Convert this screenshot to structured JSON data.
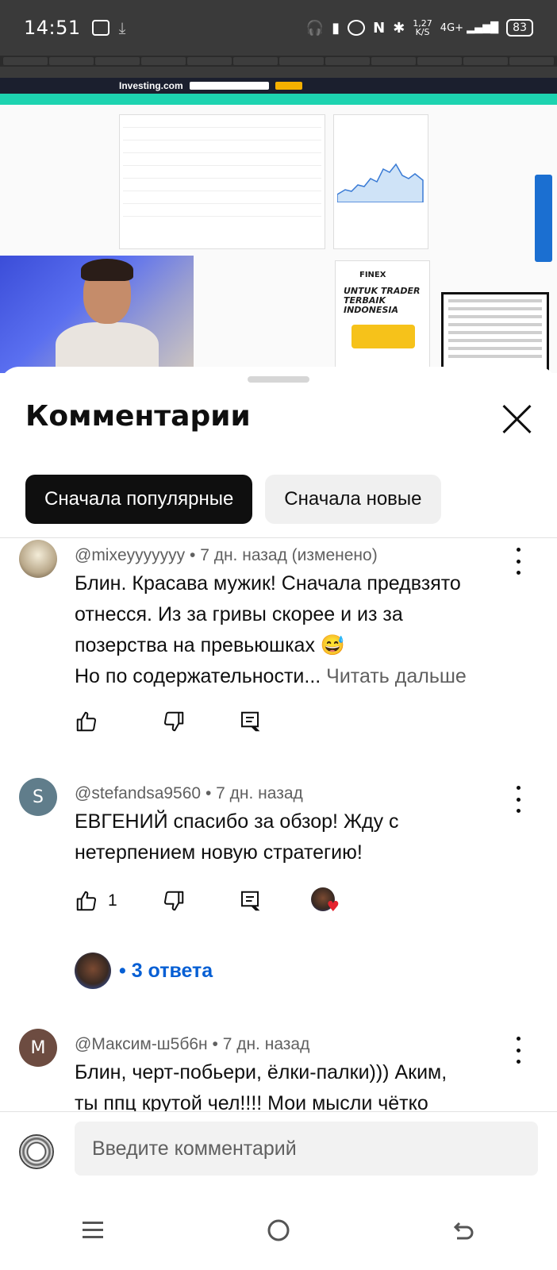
{
  "status_bar": {
    "time": "14:51",
    "net_speed_value": "1,27",
    "net_speed_unit": "K/S",
    "network": "4G+",
    "battery": "83"
  },
  "video": {
    "site_logo": "Investing.com",
    "ad_brand": "FINEX",
    "ad_text": "UNTUK TRADER TERBAIK INDONESIA"
  },
  "sheet": {
    "title": "Комментарии",
    "sort_chips": [
      {
        "label": "Сначала популярные",
        "active": true
      },
      {
        "label": "Сначала новые",
        "active": false
      }
    ]
  },
  "comments": [
    {
      "author": "@mixeyyyyyyy",
      "time": "7 дн. назад",
      "edited": "(изменено)",
      "lines": [
        "Блин. Красава мужик! Сначала предвзято",
        "отнесся. Из за гривы скорее и из за",
        "позерства  на превьюшках 😅",
        "Но по содержательности..."
      ],
      "read_more": "Читать дальше",
      "likes": ""
    },
    {
      "author": "@stefandsa9560",
      "avatar_letter": "S",
      "time": "7 дн. назад",
      "lines": [
        "ЕВГЕНИЙ спасибо за обзор! Жду с",
        "нетерпением новую стратегию!"
      ],
      "likes": "1",
      "replies_label": "3 ответа"
    },
    {
      "author": "@Максим-ш5б6н",
      "avatar_letter": "M",
      "time": "7 дн. назад",
      "lines": [
        "Блин, черт-побьери, ёлки-палки)))  Аким,",
        "ты ппц крутой чел!!!!   Мои мысли чётко"
      ]
    }
  ],
  "composer": {
    "placeholder": "Введите комментарий"
  },
  "colors": {
    "accent_link": "#065fd4",
    "chip_active_bg": "#0f0f0f",
    "chip_bg": "#f0f0f0",
    "heart": "#e5232e"
  },
  "icons": [
    "thumb-up-icon",
    "thumb-down-icon",
    "reply-icon",
    "more-vert-icon",
    "close-icon",
    "menu-icon",
    "home-icon",
    "back-icon"
  ]
}
